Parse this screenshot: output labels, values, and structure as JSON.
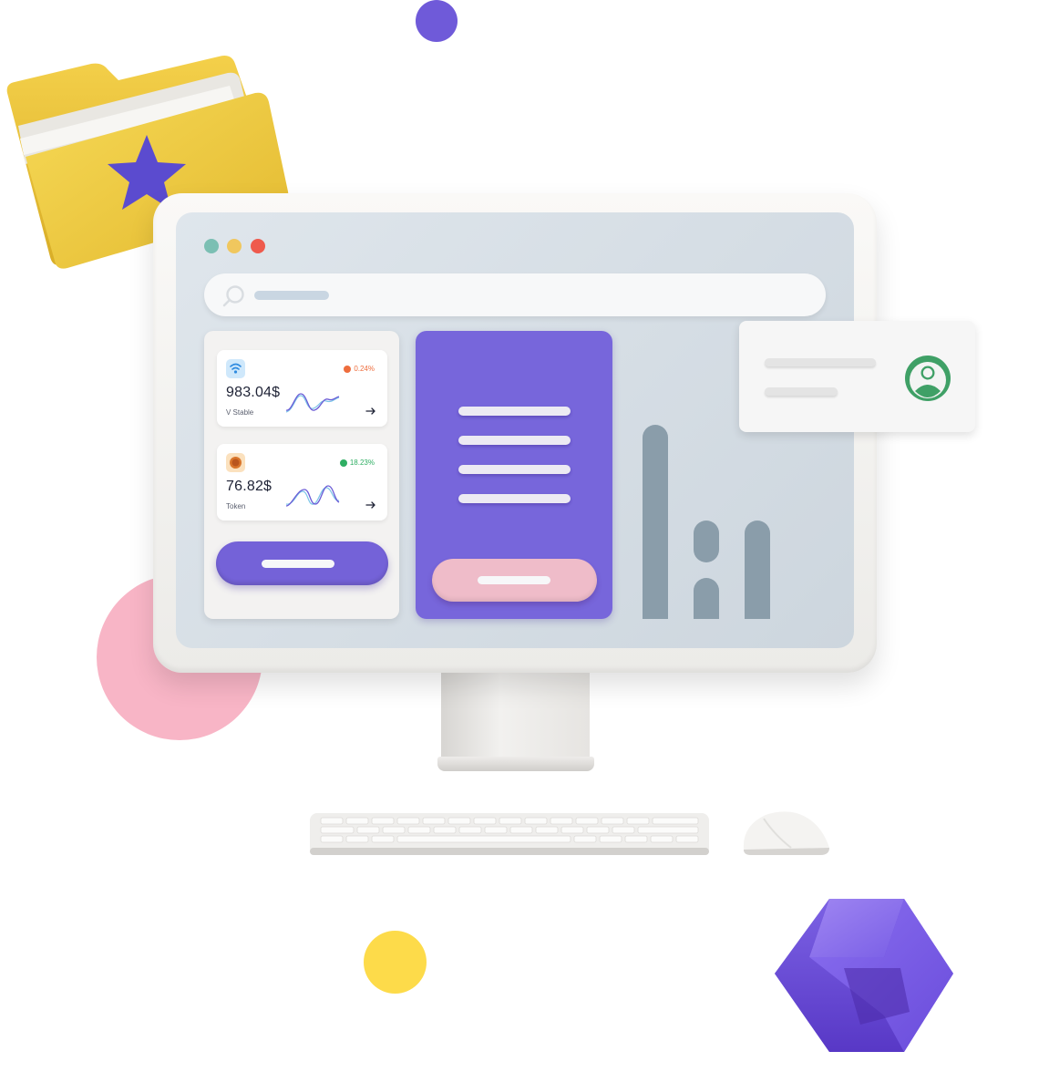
{
  "colors": {
    "accent_purple": "#7766db",
    "button_purple": "#7462d8",
    "pink_button": "#efbcc9",
    "screen_bg": "#d5dde4",
    "positive": "#2fae63",
    "negative": "#ee6d3d",
    "avatar_green": "#3fa066",
    "folder_yellow": "#f2cc3d"
  },
  "window": {
    "controls": [
      "close",
      "minimize",
      "maximize"
    ]
  },
  "search": {
    "icon": "search-icon"
  },
  "cards": [
    {
      "icon": "wifi-coin-icon",
      "change": "0.24%",
      "trend": "down",
      "value": "983.04$",
      "label": "V Stable"
    },
    {
      "icon": "orange-coin-icon",
      "change": "18.23%",
      "trend": "up",
      "value": "76.82$",
      "label": "Token"
    }
  ],
  "profile": {
    "icon": "user-avatar-icon"
  },
  "decor": {
    "folder_icon": "star-folder-icon",
    "cube_icon": "cube-icon"
  }
}
